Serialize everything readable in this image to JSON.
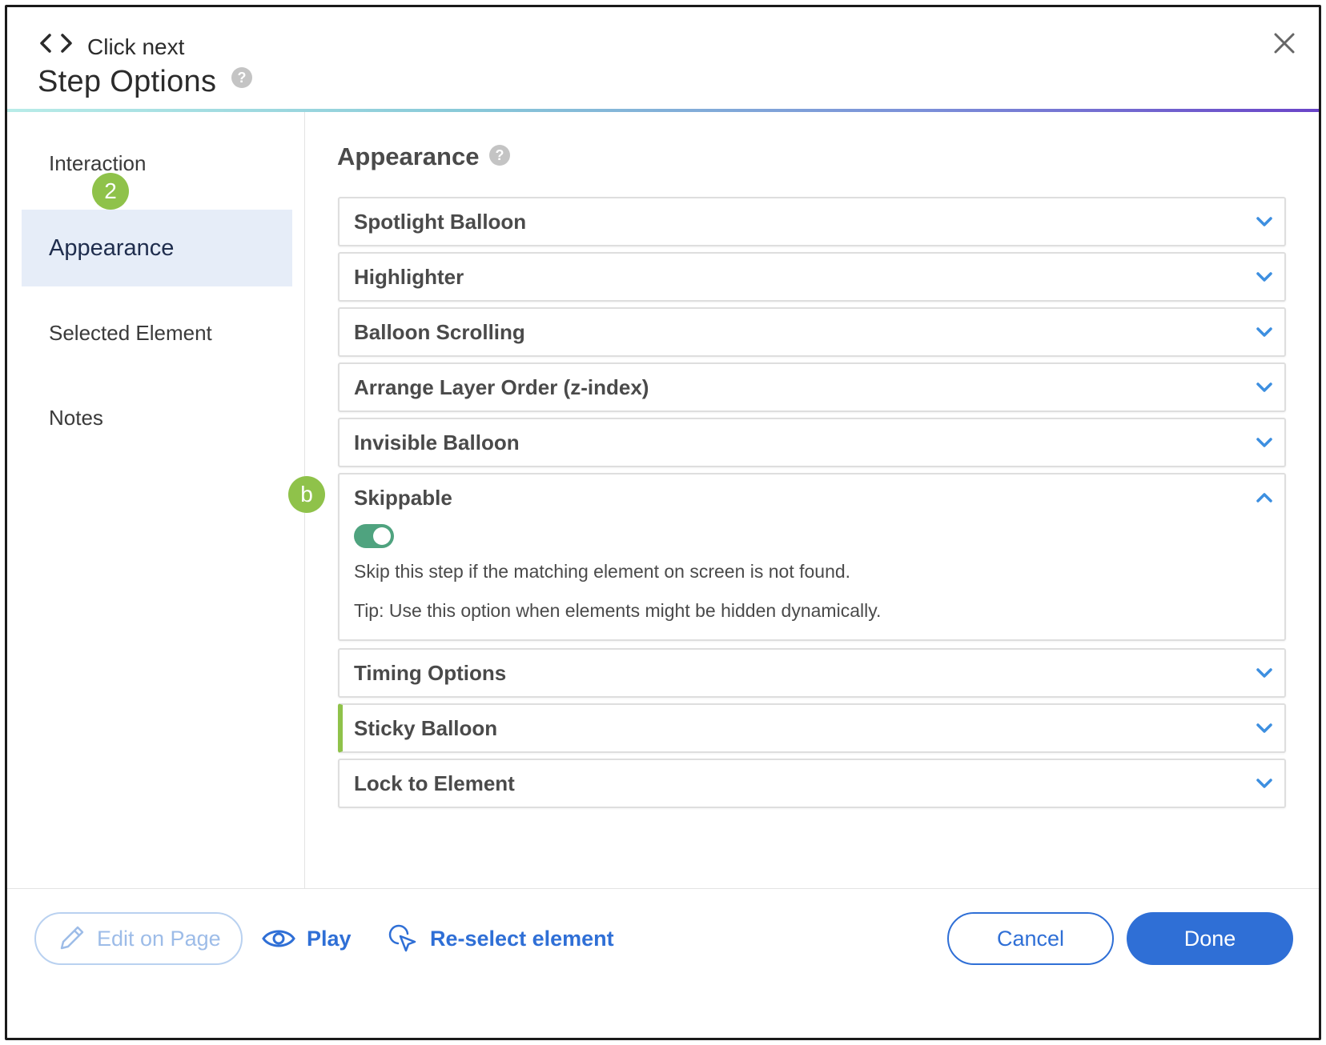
{
  "header": {
    "step_name": "Click next",
    "title": "Step Options",
    "help_symbol": "?"
  },
  "sidebar": {
    "items": [
      {
        "label": "Interaction"
      },
      {
        "label": "Appearance",
        "active": true
      },
      {
        "label": "Selected Element"
      },
      {
        "label": "Notes"
      }
    ],
    "badge": "2"
  },
  "main": {
    "section_title": "Appearance",
    "help_symbol": "?",
    "accordions": [
      {
        "label": "Spotlight Balloon"
      },
      {
        "label": "Highlighter"
      },
      {
        "label": "Balloon Scrolling"
      },
      {
        "label": "Arrange Layer Order (z-index)"
      },
      {
        "label": "Invisible Balloon"
      },
      {
        "label": "Skippable",
        "expanded": true,
        "toggle_on": true,
        "description": "Skip this step if the matching element on screen is not found.",
        "tip": "Tip: Use this option when elements might be hidden dynamically."
      },
      {
        "label": "Timing Options"
      },
      {
        "label": "Sticky Balloon"
      },
      {
        "label": "Lock to Element"
      }
    ],
    "badge": "b"
  },
  "footer": {
    "edit_label": "Edit on Page",
    "play_label": "Play",
    "reselect_label": "Re-select element",
    "cancel_label": "Cancel",
    "done_label": "Done"
  },
  "colors": {
    "primary": "#2f6fd6",
    "badge": "#8fc24a",
    "toggle": "#4fa37f",
    "active_bg": "#e6edf8"
  }
}
